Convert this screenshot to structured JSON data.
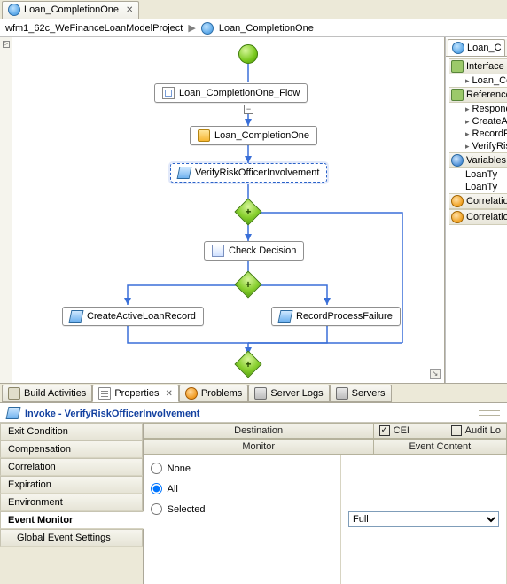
{
  "editor_tab": {
    "label": "Loan_CompletionOne"
  },
  "breadcrumb": {
    "project": "wfm1_62c_WeFinanceLoanModelProject",
    "current": "Loan_CompletionOne"
  },
  "flow": {
    "container_label": "Loan_CompletionOne_Flow",
    "receive_label": "Loan_CompletionOne",
    "invoke_verify": "VerifyRiskOfficerInvolvement",
    "check_decision": "Check Decision",
    "create_loan": "CreateActiveLoanRecord",
    "record_failure": "RecordProcessFailure"
  },
  "outline": {
    "tab": "Loan_C",
    "interface_partners": {
      "label": "Interface P",
      "child": "Loan_Co"
    },
    "reference_partners": {
      "label": "Reference",
      "children": [
        "Respond",
        "CreateA",
        "RecordP",
        "VerifyRis"
      ]
    },
    "variables": {
      "label": "Variables",
      "children": [
        "LoanTy",
        "LoanTy"
      ]
    },
    "correlation": {
      "label": "Correlation",
      "child": "Correlation"
    }
  },
  "view_tabs": {
    "build": "Build Activities",
    "properties": "Properties",
    "problems": "Problems",
    "server_logs": "Server Logs",
    "servers": "Servers"
  },
  "properties": {
    "title_prefix": "Invoke - ",
    "title_subject": "VerifyRiskOfficerInvolvement",
    "tabs": {
      "exit": "Exit Condition",
      "compensation": "Compensation",
      "correlation": "Correlation",
      "expiration": "Expiration",
      "environment": "Environment",
      "event_monitor": "Event Monitor",
      "global": "Global Event Settings"
    },
    "headers": {
      "destination": "Destination",
      "monitor": "Monitor",
      "event_content": "Event Content"
    },
    "checkboxes": {
      "cei": "CEI",
      "audit": "Audit Lo"
    },
    "radios": {
      "none": "None",
      "all": "All",
      "selected": "Selected"
    },
    "event_content_value": "Full"
  }
}
